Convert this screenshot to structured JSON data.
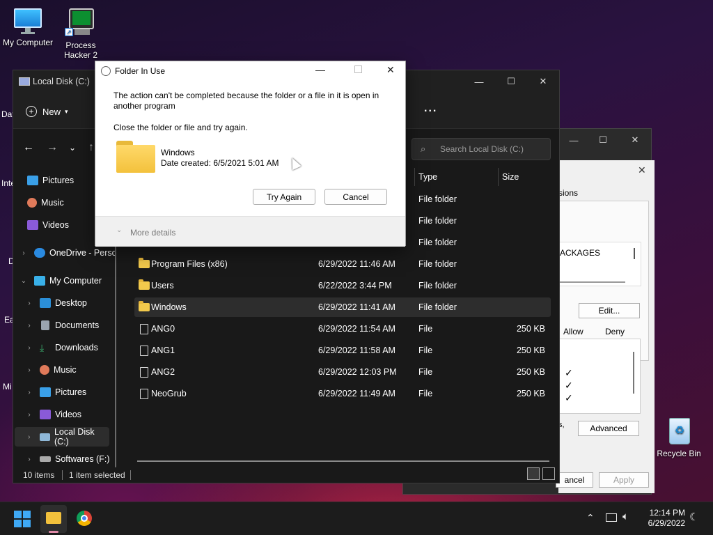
{
  "desktop": {
    "icons": [
      {
        "label": "My Computer"
      },
      {
        "label": "Process Hacker 2"
      },
      {
        "label": "Recycle Bin"
      }
    ],
    "edge_fragments": [
      "Dat",
      "Inte",
      "D",
      "Ea",
      "Mi"
    ]
  },
  "explorer": {
    "title": "Local Disk (C:)",
    "new_label": "New",
    "more_label": "...",
    "search_placeholder": "Search Local Disk (C:)",
    "columns": {
      "type": "Type",
      "size": "Size"
    },
    "nav": [
      {
        "label": "Pictures",
        "icon": "pictures-icon"
      },
      {
        "label": "Music",
        "icon": "music-icon"
      },
      {
        "label": "Videos",
        "icon": "videos-icon"
      },
      {
        "label": "OneDrive - Perso",
        "icon": "onedrive-icon"
      },
      {
        "label": "My Computer",
        "icon": "computer-icon"
      },
      {
        "label": "Desktop",
        "icon": "desktop-icon"
      },
      {
        "label": "Documents",
        "icon": "documents-icon"
      },
      {
        "label": "Downloads",
        "icon": "downloads-icon"
      },
      {
        "label": "Music",
        "icon": "music-icon"
      },
      {
        "label": "Pictures",
        "icon": "pictures-icon"
      },
      {
        "label": "Videos",
        "icon": "videos-icon"
      },
      {
        "label": "Local Disk (C:)",
        "icon": "drive-icon"
      },
      {
        "label": "Softwares (F:)",
        "icon": "drive-icon"
      }
    ],
    "rows_hidden": [
      {
        "type": "File folder"
      },
      {
        "type": "File folder"
      },
      {
        "type": "File folder"
      }
    ],
    "rows": [
      {
        "name": "Program Files (x86)",
        "date": "6/29/2022 11:46 AM",
        "type": "File folder",
        "size": "",
        "kind": "folder"
      },
      {
        "name": "Users",
        "date": "6/22/2022 3:44 PM",
        "type": "File folder",
        "size": "",
        "kind": "folder"
      },
      {
        "name": "Windows",
        "date": "6/29/2022 11:41 AM",
        "type": "File folder",
        "size": "",
        "kind": "folder"
      },
      {
        "name": "ANG0",
        "date": "6/29/2022 11:54 AM",
        "type": "File",
        "size": "250 KB",
        "kind": "file"
      },
      {
        "name": "ANG1",
        "date": "6/29/2022 11:58 AM",
        "type": "File",
        "size": "250 KB",
        "kind": "file"
      },
      {
        "name": "ANG2",
        "date": "6/29/2022 12:03 PM",
        "type": "File",
        "size": "250 KB",
        "kind": "file"
      },
      {
        "name": "NeoGrub",
        "date": "6/29/2022 11:49 AM",
        "type": "File",
        "size": "250 KB",
        "kind": "file"
      }
    ],
    "status": {
      "count": "10 items",
      "selected": "1 item selected"
    }
  },
  "properties": {
    "tab_fragment": "sions",
    "list_fragment": "ACKAGES",
    "edit_label": "Edit...",
    "allow_label": "Allow",
    "deny_label": "Deny",
    "fragment_s": "s,",
    "advanced_label": "Advanced",
    "cancel_fragment": "ancel",
    "apply_label": "Apply"
  },
  "dialog": {
    "title": "Folder In Use",
    "message": "The action can't be completed because the folder or a file in it is open in another program",
    "instruction": "Close the folder or file and try again.",
    "item_name": "Windows",
    "item_date": "Date created: 6/5/2021 5:01 AM",
    "try_again_label": "Try Again",
    "cancel_label": "Cancel",
    "more_details_label": "More details"
  },
  "taskbar": {
    "time": "12:14 PM",
    "date": "6/29/2022"
  }
}
